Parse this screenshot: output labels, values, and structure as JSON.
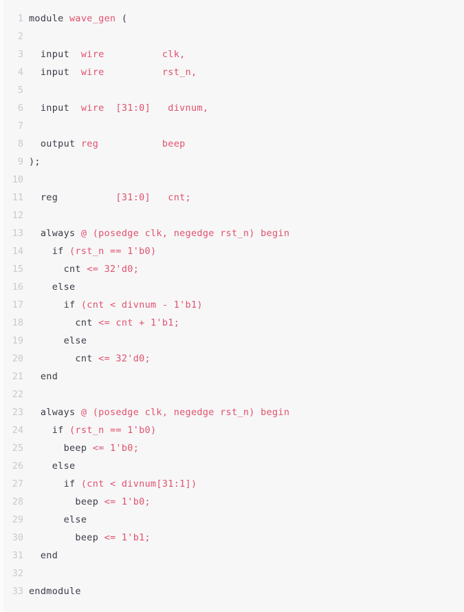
{
  "editor": {
    "language": "verilog",
    "background_color": "#f7f7f8",
    "gutter_text_color": "#c9c9cf",
    "plain_text_color": "#3a3a46",
    "accent_text_color": "#e0516b",
    "total_lines": 33
  },
  "lines": [
    {
      "number": "1",
      "tokens": [
        {
          "t": "module ",
          "c": "plain"
        },
        {
          "t": "wave_gen ",
          "c": "accent"
        },
        {
          "t": "(",
          "c": "plain"
        }
      ]
    },
    {
      "number": "2",
      "tokens": []
    },
    {
      "number": "3",
      "tokens": [
        {
          "t": "  input  ",
          "c": "plain"
        },
        {
          "t": "wire",
          "c": "accent"
        },
        {
          "t": "          ",
          "c": "plain"
        },
        {
          "t": "clk,",
          "c": "accent"
        }
      ]
    },
    {
      "number": "4",
      "tokens": [
        {
          "t": "  input  ",
          "c": "plain"
        },
        {
          "t": "wire",
          "c": "accent"
        },
        {
          "t": "          ",
          "c": "plain"
        },
        {
          "t": "rst_n,",
          "c": "accent"
        }
      ]
    },
    {
      "number": "5",
      "tokens": []
    },
    {
      "number": "6",
      "tokens": [
        {
          "t": "  input  ",
          "c": "plain"
        },
        {
          "t": "wire  [31:0]   divnum,",
          "c": "accent"
        }
      ]
    },
    {
      "number": "7",
      "tokens": []
    },
    {
      "number": "8",
      "tokens": [
        {
          "t": "  output ",
          "c": "plain"
        },
        {
          "t": "reg",
          "c": "accent"
        },
        {
          "t": "           ",
          "c": "plain"
        },
        {
          "t": "beep",
          "c": "accent"
        }
      ]
    },
    {
      "number": "9",
      "tokens": [
        {
          "t": ");",
          "c": "plain"
        }
      ]
    },
    {
      "number": "10",
      "tokens": []
    },
    {
      "number": "11",
      "tokens": [
        {
          "t": "  reg          ",
          "c": "plain"
        },
        {
          "t": "[31:0]   cnt;",
          "c": "accent"
        }
      ]
    },
    {
      "number": "12",
      "tokens": []
    },
    {
      "number": "13",
      "tokens": [
        {
          "t": "  always ",
          "c": "plain"
        },
        {
          "t": "@ (posedge clk, negedge rst_n) begin",
          "c": "accent"
        }
      ]
    },
    {
      "number": "14",
      "tokens": [
        {
          "t": "    if ",
          "c": "plain"
        },
        {
          "t": "(rst_n == 1'b0)",
          "c": "accent"
        }
      ]
    },
    {
      "number": "15",
      "tokens": [
        {
          "t": "      cnt ",
          "c": "plain"
        },
        {
          "t": "<= 32'd0;",
          "c": "accent"
        }
      ]
    },
    {
      "number": "16",
      "tokens": [
        {
          "t": "    else",
          "c": "plain"
        }
      ]
    },
    {
      "number": "17",
      "tokens": [
        {
          "t": "      if ",
          "c": "plain"
        },
        {
          "t": "(cnt < divnum - 1'b1)",
          "c": "accent"
        }
      ]
    },
    {
      "number": "18",
      "tokens": [
        {
          "t": "        cnt ",
          "c": "plain"
        },
        {
          "t": "<= cnt + 1'b1;",
          "c": "accent"
        }
      ]
    },
    {
      "number": "19",
      "tokens": [
        {
          "t": "      else",
          "c": "plain"
        }
      ]
    },
    {
      "number": "20",
      "tokens": [
        {
          "t": "        cnt ",
          "c": "plain"
        },
        {
          "t": "<= 32'd0;",
          "c": "accent"
        }
      ]
    },
    {
      "number": "21",
      "tokens": [
        {
          "t": "  end",
          "c": "plain"
        }
      ]
    },
    {
      "number": "22",
      "tokens": []
    },
    {
      "number": "23",
      "tokens": [
        {
          "t": "  always ",
          "c": "plain"
        },
        {
          "t": "@ (posedge clk, negedge rst_n) begin",
          "c": "accent"
        }
      ]
    },
    {
      "number": "24",
      "tokens": [
        {
          "t": "    if ",
          "c": "plain"
        },
        {
          "t": "(rst_n == 1'b0)",
          "c": "accent"
        }
      ]
    },
    {
      "number": "25",
      "tokens": [
        {
          "t": "      beep ",
          "c": "plain"
        },
        {
          "t": "<= 1'b0;",
          "c": "accent"
        }
      ]
    },
    {
      "number": "26",
      "tokens": [
        {
          "t": "    else",
          "c": "plain"
        }
      ]
    },
    {
      "number": "27",
      "tokens": [
        {
          "t": "      if ",
          "c": "plain"
        },
        {
          "t": "(cnt < divnum[31:1])",
          "c": "accent"
        }
      ]
    },
    {
      "number": "28",
      "tokens": [
        {
          "t": "        beep ",
          "c": "plain"
        },
        {
          "t": "<= 1'b0;",
          "c": "accent"
        }
      ]
    },
    {
      "number": "29",
      "tokens": [
        {
          "t": "      else",
          "c": "plain"
        }
      ]
    },
    {
      "number": "30",
      "tokens": [
        {
          "t": "        beep ",
          "c": "plain"
        },
        {
          "t": "<= 1'b1;",
          "c": "accent"
        }
      ]
    },
    {
      "number": "31",
      "tokens": [
        {
          "t": "  end",
          "c": "plain"
        }
      ]
    },
    {
      "number": "32",
      "tokens": []
    },
    {
      "number": "33",
      "tokens": [
        {
          "t": "endmodule",
          "c": "plain"
        }
      ]
    }
  ]
}
